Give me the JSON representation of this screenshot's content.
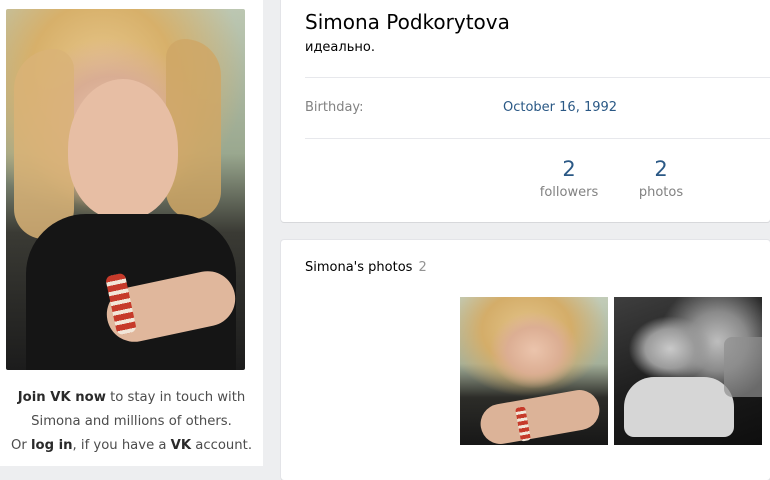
{
  "profile": {
    "name": "Simona Podkorytova",
    "status": "идеально.",
    "info": [
      {
        "label": "Birthday:",
        "value": "October 16, 1992"
      }
    ],
    "counters": [
      {
        "value": "2",
        "label": "followers"
      },
      {
        "value": "2",
        "label": "photos"
      }
    ]
  },
  "sidebar": {
    "join_link": "Join VK now",
    "join_rest": " to stay in touch with Simona and millions of others.",
    "or_text": "Or ",
    "login_link": "log in",
    "if_text": ", if you have a ",
    "vk_link": "VK",
    "account_text": " account."
  },
  "photos": {
    "title": "Simona's photos",
    "count": "2"
  },
  "colors": {
    "link": "#2a5885",
    "muted": "#828282",
    "background": "#edeef0"
  }
}
